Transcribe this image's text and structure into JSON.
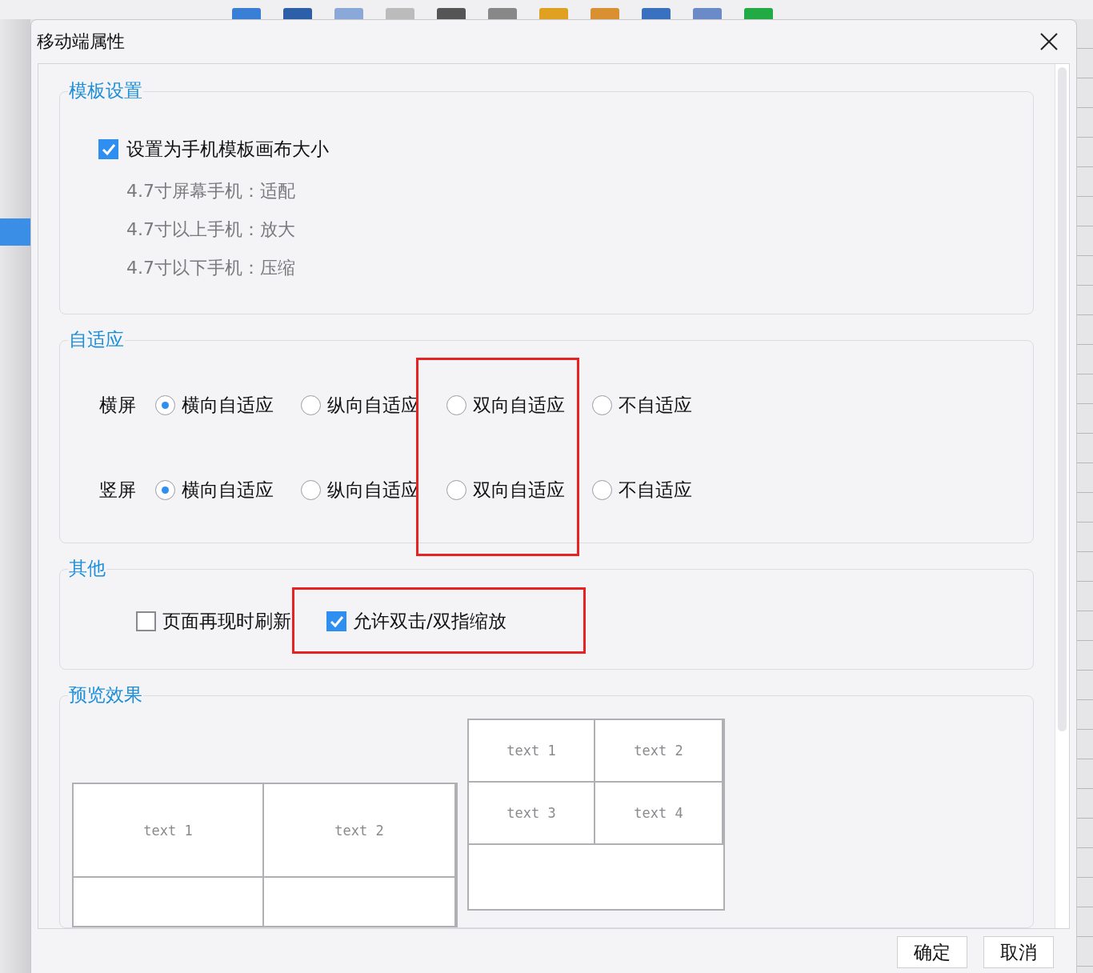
{
  "dialog": {
    "title": "移动端属性"
  },
  "template_settings": {
    "title": "模板设置",
    "checkbox": {
      "label": "设置为手机模板画布大小",
      "checked": true
    },
    "notes": [
      "4.7寸屏幕手机：适配",
      "4.7寸以上手机：放大",
      "4.7寸以下手机：压缩"
    ]
  },
  "adaptive": {
    "title": "自适应",
    "rows": [
      {
        "label": "横屏",
        "options": [
          {
            "label": "横向自适应",
            "selected": true,
            "highlighted": false
          },
          {
            "label": "纵向自适应",
            "selected": false,
            "highlighted": false
          },
          {
            "label": "双向自适应",
            "selected": false,
            "highlighted": true
          },
          {
            "label": "不自适应",
            "selected": false,
            "highlighted": false
          }
        ]
      },
      {
        "label": "竖屏",
        "options": [
          {
            "label": "横向自适应",
            "selected": true,
            "highlighted": false
          },
          {
            "label": "纵向自适应",
            "selected": false,
            "highlighted": false
          },
          {
            "label": "双向自适应",
            "selected": false,
            "highlighted": true
          },
          {
            "label": "不自适应",
            "selected": false,
            "highlighted": false
          }
        ]
      }
    ]
  },
  "other": {
    "title": "其他",
    "checkboxes": [
      {
        "label": "页面再现时刷新",
        "checked": false,
        "highlighted": false
      },
      {
        "label": "允许双击/双指缩放",
        "checked": true,
        "highlighted": true
      }
    ]
  },
  "preview": {
    "title": "预览效果",
    "landscape": {
      "cells": [
        "text 1",
        "text 2"
      ]
    },
    "portrait": {
      "cells": [
        "text 1",
        "text 2",
        "text 3",
        "text 4"
      ]
    }
  },
  "buttons": [
    "确定",
    "取消"
  ]
}
